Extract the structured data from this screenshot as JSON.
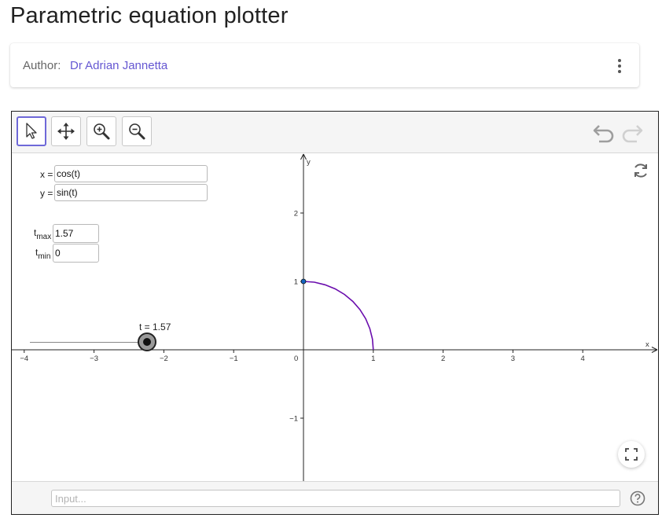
{
  "page": {
    "title": "Parametric equation plotter"
  },
  "author": {
    "label": "Author:",
    "name": "Dr Adrian Jannetta"
  },
  "toolbar": {
    "tools": [
      {
        "name": "move-tool",
        "icon": "arrow-pointer-icon",
        "active": true
      },
      {
        "name": "move-graphics-view-tool",
        "icon": "four-way-arrows-icon",
        "active": false
      },
      {
        "name": "zoom-in-tool",
        "icon": "zoom-in-icon",
        "active": false
      },
      {
        "name": "zoom-out-tool",
        "icon": "zoom-out-icon",
        "active": false
      }
    ],
    "undo_icon": "undo-icon",
    "redo_icon": "redo-icon"
  },
  "equations": {
    "x_label": "x =",
    "x_value": "cos(t)",
    "y_label": "y =",
    "y_value": "sin(t)"
  },
  "t_range": {
    "tmax_base": "t",
    "tmax_sub": "max",
    "tmax_value": "1.57",
    "tmin_base": "t",
    "tmin_sub": "min",
    "tmin_value": "0"
  },
  "slider": {
    "caption": "t = 1.57",
    "value": 1.57,
    "min": 0,
    "max": 1.57
  },
  "graph": {
    "x_axis_label": "x",
    "y_axis_label": "y",
    "x_ticks": [
      "−4",
      "−3",
      "−2",
      "−1",
      "0",
      "1",
      "2",
      "3",
      "4"
    ],
    "y_ticks": [
      "2",
      "1",
      "−1"
    ],
    "curve_color": "#6a0dad",
    "point_color": "#1565c0"
  },
  "chart_data": {
    "type": "line",
    "title": "",
    "xlabel": "x",
    "ylabel": "y",
    "xlim": [
      -4,
      5
    ],
    "ylim": [
      -1.9,
      2.8
    ],
    "series": [
      {
        "x": [
          1,
          0.988,
          0.951,
          0.891,
          0.809,
          0.707,
          0.588,
          0.454,
          0.309,
          0.156,
          0
        ],
        "y": [
          0,
          0.156,
          0.309,
          0.454,
          0.588,
          0.707,
          0.809,
          0.891,
          0.951,
          0.988,
          1
        ]
      }
    ],
    "points": [
      {
        "x": 0,
        "y": 1
      }
    ]
  },
  "input_bar": {
    "placeholder": "Input..."
  },
  "icons": {
    "more": "more-vertical-icon",
    "reset": "refresh-icon",
    "fullscreen": "fullscreen-icon",
    "help": "help-icon"
  }
}
